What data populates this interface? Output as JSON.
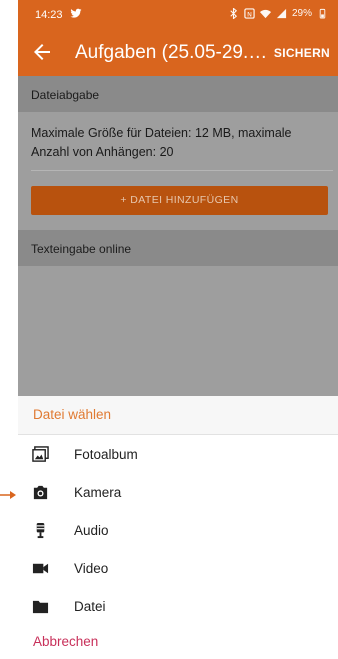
{
  "status_bar": {
    "time": "14:23",
    "battery": "29%"
  },
  "app_bar": {
    "title": "Aufgaben (25.05-29.05...",
    "action": "SICHERN"
  },
  "content": {
    "section1": "Dateiabgabe",
    "description": "Maximale Größe für Dateien: 12 MB, maximale Anzahl von Anhängen: 20",
    "add_file_button": "+ DATEI HINZUFÜGEN",
    "section2": "Texteingabe online"
  },
  "sheet": {
    "title": "Datei wählen",
    "options": [
      {
        "label": "Fotoalbum",
        "icon": "photo-album-icon"
      },
      {
        "label": "Kamera",
        "icon": "camera-icon"
      },
      {
        "label": "Audio",
        "icon": "microphone-icon"
      },
      {
        "label": "Video",
        "icon": "videocam-icon"
      },
      {
        "label": "Datei",
        "icon": "folder-icon"
      }
    ],
    "cancel": "Abbrechen"
  },
  "colors": {
    "primary": "#d9651e",
    "accent_text": "#e07a32",
    "cancel_text": "#c8305a",
    "pointer": "#d9651e"
  }
}
